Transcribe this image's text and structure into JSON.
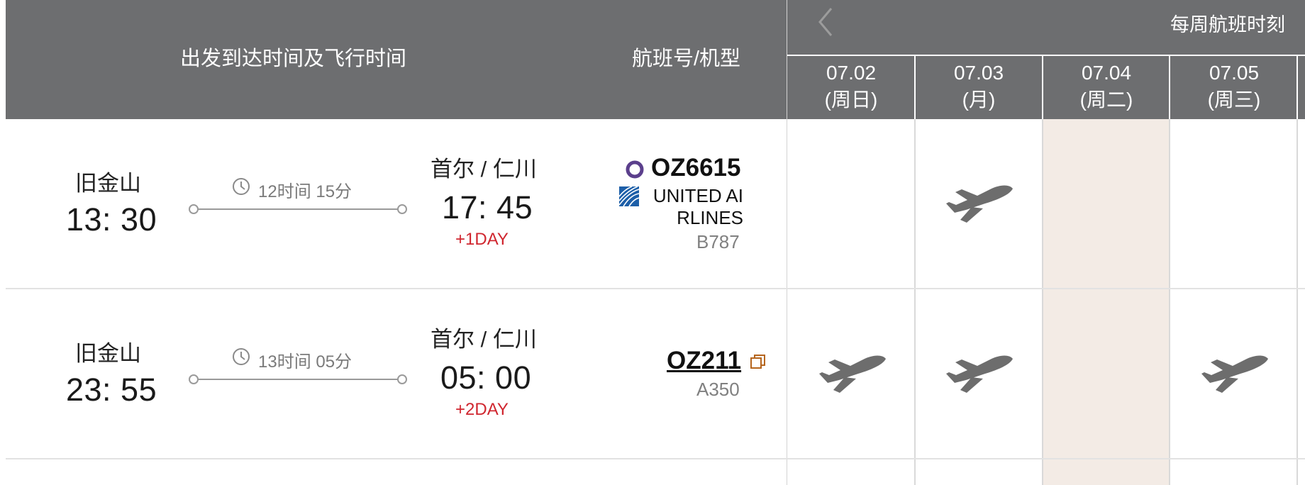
{
  "header": {
    "dep_arr_title": "出发到达时间及飞行时间",
    "flight_title": "航班号/机型",
    "weekly_title": "每周航班时刻",
    "prev_icon": "chevron-left-icon",
    "days": [
      {
        "date": "07.02",
        "weekday": "(周日)"
      },
      {
        "date": "07.03",
        "weekday": "(月)"
      },
      {
        "date": "07.04",
        "weekday": "(周二)"
      },
      {
        "date": "07.05",
        "weekday": "(周三)"
      }
    ]
  },
  "flights": [
    {
      "dep_city": "旧金山",
      "dep_time": "13: 30",
      "duration": "12时间 15分",
      "arr_city": "首尔 / 仁川",
      "arr_time": "17: 45",
      "day_offset": "+1DAY",
      "flight_no": "OZ6615",
      "operator_line1": "UNITED AI",
      "operator_line2": "RLINES",
      "aircraft": "B787",
      "operates": [
        false,
        true,
        false,
        false
      ]
    },
    {
      "dep_city": "旧金山",
      "dep_time": "23: 55",
      "duration": "13时间 05分",
      "arr_city": "首尔 / 仁川",
      "arr_time": "05: 00",
      "day_offset": "+2DAY",
      "flight_no": "OZ211",
      "aircraft": "A350",
      "operates": [
        true,
        true,
        false,
        true
      ]
    }
  ],
  "colors": {
    "header_bg": "#6d6e70",
    "highlight_col": "#f3ebe5",
    "day_offset": "#d0262f",
    "codeshare_ring": "#5b3f8c",
    "united_blue": "#1d5fa8",
    "copy_icon": "#b5651d"
  }
}
